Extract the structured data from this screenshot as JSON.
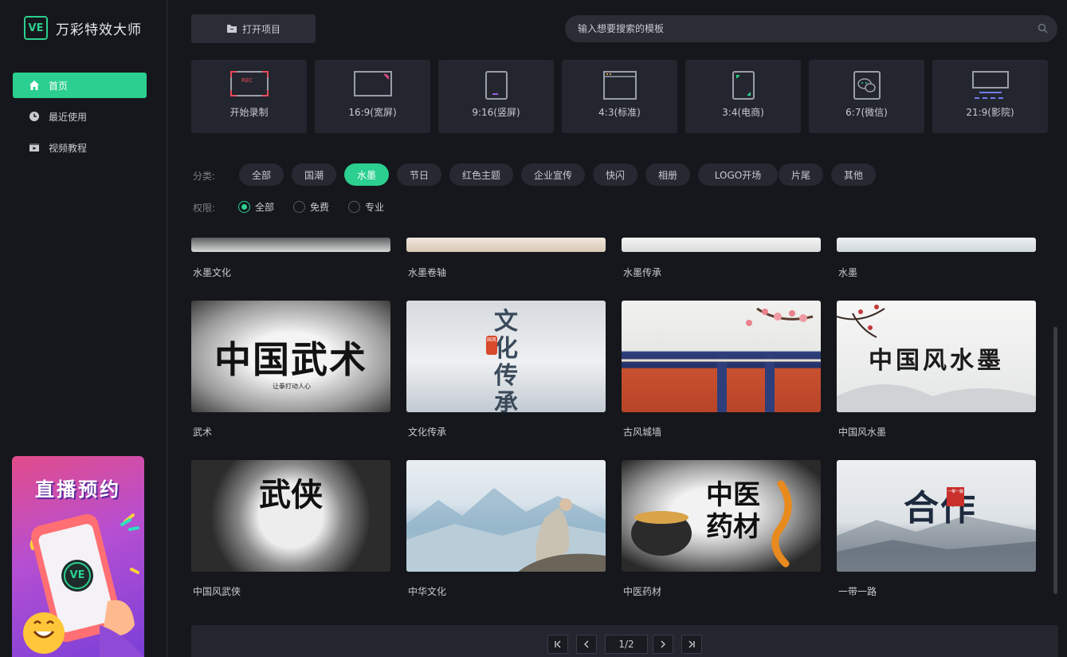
{
  "app": {
    "name": "万彩特效大师",
    "logo_mark": "VE"
  },
  "sidebar": {
    "items": [
      {
        "label": "首页",
        "icon": "home-icon",
        "active": true
      },
      {
        "label": "最近使用",
        "icon": "clock-icon",
        "active": false
      },
      {
        "label": "视频教程",
        "icon": "video-tutorial-icon",
        "active": false
      }
    ],
    "promo": {
      "title": "直播预约",
      "badge": "VE"
    }
  },
  "toolbar": {
    "open_project_label": "打开项目",
    "open_project_icon": "folder-icon"
  },
  "search": {
    "placeholder": "输入想要搜索的模板",
    "icon": "search-icon"
  },
  "ratios": [
    {
      "label": "开始录制",
      "icon": "record-icon",
      "badge": "REC"
    },
    {
      "label": "16:9(宽屏)",
      "icon": "widescreen-icon"
    },
    {
      "label": "9:16(竖屏)",
      "icon": "portrait-icon"
    },
    {
      "label": "4:3(标准)",
      "icon": "standard-icon"
    },
    {
      "label": "3:4(电商)",
      "icon": "ecommerce-icon"
    },
    {
      "label": "6:7(微信)",
      "icon": "wechat-icon"
    },
    {
      "label": "21:9(影院)",
      "icon": "cinema-icon"
    }
  ],
  "filters": {
    "category_label": "分类:",
    "categories": [
      "全部",
      "国潮",
      "水墨",
      "节日",
      "红色主题",
      "企业宣传",
      "快闪",
      "相册",
      "LOGO开场",
      "片尾",
      "其他"
    ],
    "active_category": "水墨",
    "permission_label": "权限:",
    "permissions": [
      "全部",
      "免费",
      "专业"
    ],
    "active_permission": "全部"
  },
  "templates": {
    "partial_row": [
      "水墨文化",
      "水墨卷轴",
      "水墨传承",
      "水墨"
    ],
    "rows": [
      [
        {
          "title": "武术",
          "art": "中国武术",
          "sub": "让拳打动人心"
        },
        {
          "title": "文化传承",
          "art": "文化传承",
          "seal": "国风"
        },
        {
          "title": "古风城墙",
          "art": ""
        },
        {
          "title": "中国风水墨",
          "art": "中国风水墨"
        }
      ],
      [
        {
          "title": "中国风武侠",
          "art": "武侠"
        },
        {
          "title": "中华文化",
          "art": ""
        },
        {
          "title": "中医药材",
          "art": "中医药材"
        },
        {
          "title": "一带一路",
          "art": "合作",
          "seal": "一带一路"
        }
      ]
    ]
  },
  "pagination": {
    "page_display": "1/2",
    "current_page": 1,
    "total_pages": 2
  },
  "colors": {
    "accent": "#2bcf8f",
    "background": "#15171c",
    "panel": "#23262e"
  }
}
